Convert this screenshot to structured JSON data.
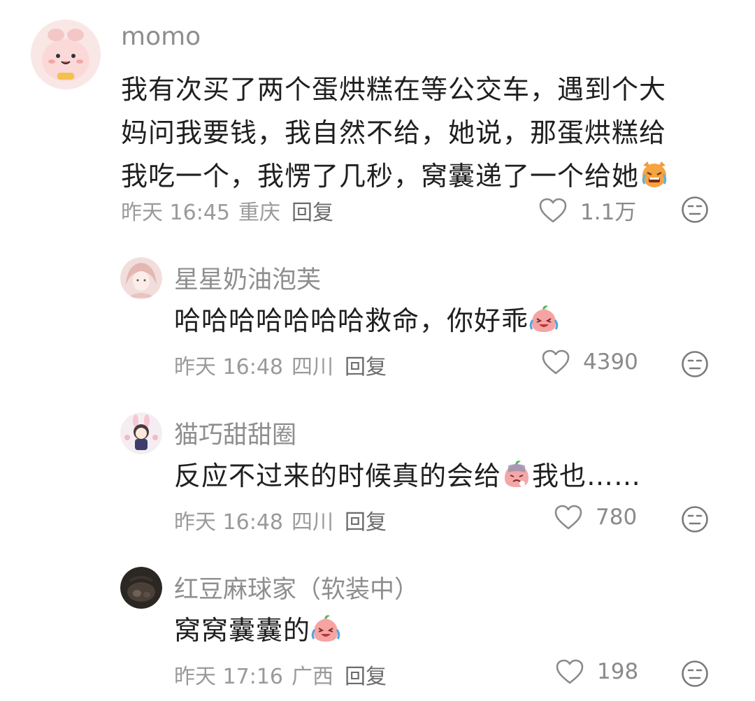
{
  "comments": [
    {
      "username": "momo",
      "text_lines": [
        "我有次买了两个蛋烘糕在等公交车，遇到个大",
        "妈问我要钱，我自然不给，她说，那蛋烘糕给",
        "我吃一个，我愣了几秒，窝囊递了一个给她"
      ],
      "emoji": "crying-cat-emoji",
      "time": "昨天 16:45",
      "location": "重庆",
      "reply_label": "回复",
      "likes": "1.1万"
    },
    {
      "username": "星星奶油泡芙",
      "text_lines": [
        "哈哈哈哈哈哈哈救命，你好乖"
      ],
      "emoji": "laughing-peach-emoji",
      "time": "昨天 16:48",
      "location": "四川",
      "reply_label": "回复",
      "likes": "4390"
    },
    {
      "username": "猫巧甜甜圈",
      "text_lines": [
        "反应不过来的时候真的会给"
      ],
      "text_suffix": "我也……",
      "emoji": "sad-peach-emoji",
      "time": "昨天 16:48",
      "location": "四川",
      "reply_label": "回复",
      "likes": "780"
    },
    {
      "username": "红豆麻球家（软装中）",
      "text_lines": [
        "窝窝囊囊的"
      ],
      "emoji": "laughing-peach-emoji",
      "time": "昨天 17:16",
      "location": "广西",
      "reply_label": "回复",
      "likes": "198"
    }
  ],
  "icons": {
    "like": "heart-outline-icon",
    "dislike": "neutral-face-icon"
  },
  "colors": {
    "username": "#8e8e8e",
    "text": "#1f1f1f",
    "meta": "#9a9a9a"
  }
}
